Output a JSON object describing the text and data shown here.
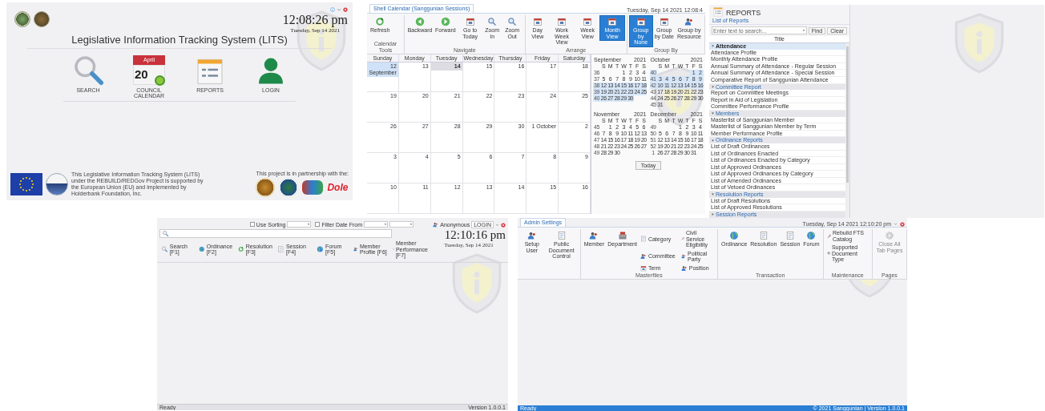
{
  "home": {
    "window_controls": [
      {
        "kind": "info"
      },
      {
        "kind": "chevron"
      },
      {
        "kind": "close"
      }
    ],
    "clock": "12:08:26 pm",
    "date": "Tuesday, Sep 14 2021",
    "title": "Legislative Information Tracking System (LITS)",
    "tiles": [
      {
        "kind": "search",
        "label": "SEARCH"
      },
      {
        "kind": "calendar",
        "label": "COUNCIL CALENDAR",
        "month": "April",
        "day": "20"
      },
      {
        "kind": "reports",
        "label": "REPORTS"
      },
      {
        "kind": "login",
        "label": "LOGIN"
      }
    ],
    "footer_text": "This Legislative Information Tracking System (LITS) under the REBUILD/REDGov Project is supported by the European Union (EU) and implemented by Holderbank Foundation, Inc.",
    "partner_text": "This project is in partnership with the:",
    "partner_logo": "Dole"
  },
  "calendar": {
    "tab": "Shell Calendar (Sanggunian Sessions)",
    "header": "Tuesday, Sep 14 2021 12:08:4",
    "ribbon_groups": [
      {
        "label": "Calendar Tools",
        "buttons": [
          {
            "kind": "refresh",
            "label": "Refresh",
            "selected": false
          }
        ]
      },
      {
        "label": "Navigate",
        "buttons": [
          {
            "kind": "back",
            "label": "Backward",
            "selected": false
          },
          {
            "kind": "forward",
            "label": "Forward",
            "selected": false
          },
          {
            "kind": "calendar",
            "label": "Go to Today",
            "selected": false
          },
          {
            "kind": "zoom",
            "label": "Zoom In",
            "selected": false
          },
          {
            "kind": "zoom",
            "label": "Zoom Out",
            "selected": false
          }
        ]
      },
      {
        "label": "Arrange",
        "buttons": [
          {
            "kind": "calendar",
            "label": "Day View",
            "selected": false
          },
          {
            "kind": "calendar",
            "label": "Work Week View",
            "selected": false
          },
          {
            "kind": "calendar",
            "label": "Week View",
            "selected": false
          },
          {
            "kind": "calendar",
            "label": "Month View",
            "selected": true
          }
        ]
      },
      {
        "label": "Group By",
        "buttons": [
          {
            "kind": "calendar",
            "label": "Group by None",
            "selected": true
          },
          {
            "kind": "calendar",
            "label": "Group by Date",
            "selected": false
          },
          {
            "kind": "people",
            "label": "Group by Resource",
            "selected": false
          }
        ]
      }
    ],
    "day_names": [
      "Sunday",
      "Monday",
      "Tuesday",
      "Wednesday",
      "Thursday",
      "Friday",
      "Saturday"
    ],
    "weeks": [
      {
        "days": [
          {
            "label": "12 September",
            "selected": true,
            "today": false
          },
          {
            "label": "13",
            "selected": false,
            "today": false
          },
          {
            "label": "14",
            "selected": false,
            "today": true
          },
          {
            "label": "15",
            "selected": false,
            "today": false
          },
          {
            "label": "16",
            "selected": false,
            "today": false
          },
          {
            "label": "17",
            "selected": false,
            "today": false
          },
          {
            "label": "18",
            "selected": false,
            "today": false
          }
        ]
      },
      {
        "days": [
          {
            "label": "19",
            "selected": false,
            "today": false
          },
          {
            "label": "20",
            "selected": false,
            "today": false
          },
          {
            "label": "21",
            "selected": false,
            "today": false
          },
          {
            "label": "22",
            "selected": false,
            "today": false
          },
          {
            "label": "23",
            "selected": false,
            "today": false
          },
          {
            "label": "24",
            "selected": false,
            "today": false
          },
          {
            "label": "25",
            "selected": false,
            "today": false
          }
        ]
      },
      {
        "days": [
          {
            "label": "26",
            "selected": false,
            "today": false
          },
          {
            "label": "27",
            "selected": false,
            "today": false
          },
          {
            "label": "28",
            "selected": false,
            "today": false
          },
          {
            "label": "29",
            "selected": false,
            "today": false
          },
          {
            "label": "30",
            "selected": false,
            "today": false
          },
          {
            "label": "1 October",
            "selected": false,
            "today": false
          },
          {
            "label": "2",
            "selected": false,
            "today": false
          }
        ]
      },
      {
        "days": [
          {
            "label": "3",
            "selected": false,
            "today": false
          },
          {
            "label": "4",
            "selected": false,
            "today": false
          },
          {
            "label": "5",
            "selected": false,
            "today": false
          },
          {
            "label": "6",
            "selected": false,
            "today": false
          },
          {
            "label": "7",
            "selected": false,
            "today": false
          },
          {
            "label": "8",
            "selected": false,
            "today": false
          },
          {
            "label": "9",
            "selected": false,
            "today": false
          }
        ]
      },
      {
        "days": [
          {
            "label": "10",
            "selected": false,
            "today": false
          },
          {
            "label": "11",
            "selected": false,
            "today": false
          },
          {
            "label": "12",
            "selected": false,
            "today": false
          },
          {
            "label": "13",
            "selected": false,
            "today": false
          },
          {
            "label": "14",
            "selected": false,
            "today": false
          },
          {
            "label": "15",
            "selected": false,
            "today": false
          },
          {
            "label": "16",
            "selected": false,
            "today": false
          }
        ]
      }
    ],
    "mini_months": [
      {
        "month": "September",
        "year": "2021",
        "weekdays": [
          "S",
          "M",
          "T",
          "W",
          "T",
          "F",
          "S"
        ],
        "weeks": [
          {
            "number": "36",
            "days": [
              "1",
              "2",
              "3",
              "4"
            ],
            "selected": false
          },
          {
            "number": "37",
            "days": [
              "5",
              "6",
              "7",
              "8",
              "9",
              "10",
              "11"
            ],
            "selected": false
          },
          {
            "number": "38",
            "days": [
              "12",
              "13",
              "14",
              "15",
              "16",
              "17",
              "18"
            ],
            "selected": true
          },
          {
            "number": "39",
            "days": [
              "19",
              "20",
              "21",
              "22",
              "23",
              "24",
              "25"
            ],
            "selected": true
          },
          {
            "number": "40",
            "days": [
              "26",
              "27",
              "28",
              "29",
              "30"
            ],
            "selected": true
          }
        ]
      },
      {
        "month": "October",
        "year": "2021",
        "weekdays": [
          "S",
          "M",
          "T",
          "W",
          "T",
          "F",
          "S"
        ],
        "weeks": [
          {
            "number": "40",
            "days": [
              "1",
              "2"
            ],
            "selected": true
          },
          {
            "number": "41",
            "days": [
              "3",
              "4",
              "5",
              "6",
              "7",
              "8",
              "9"
            ],
            "selected": true
          },
          {
            "number": "42",
            "days": [
              "10",
              "11",
              "12",
              "13",
              "14",
              "15",
              "16"
            ],
            "selected": true
          },
          {
            "number": "43",
            "days": [
              "17",
              "18",
              "19",
              "20",
              "21",
              "22",
              "23"
            ],
            "selected": false
          },
          {
            "number": "44",
            "days": [
              "24",
              "25",
              "26",
              "27",
              "28",
              "29",
              "30"
            ],
            "selected": false
          },
          {
            "number": "45",
            "days": [
              "31"
            ],
            "selected": false
          }
        ]
      },
      {
        "month": "November",
        "year": "2021",
        "weekdays": [
          "S",
          "M",
          "T",
          "W",
          "T",
          "F",
          "S"
        ],
        "weeks": [
          {
            "number": "45",
            "days": [
              "1",
              "2",
              "3",
              "4",
              "5",
              "6"
            ],
            "selected": false
          },
          {
            "number": "46",
            "days": [
              "7",
              "8",
              "9",
              "10",
              "11",
              "12",
              "13"
            ],
            "selected": false
          },
          {
            "number": "47",
            "days": [
              "14",
              "15",
              "16",
              "17",
              "18",
              "19",
              "20"
            ],
            "selected": false
          },
          {
            "number": "48",
            "days": [
              "21",
              "22",
              "23",
              "24",
              "25",
              "26",
              "27"
            ],
            "selected": false
          },
          {
            "number": "49",
            "days": [
              "28",
              "29",
              "30"
            ],
            "selected": false
          }
        ]
      },
      {
        "month": "December",
        "year": "2021",
        "weekdays": [
          "S",
          "M",
          "T",
          "W",
          "T",
          "F",
          "S"
        ],
        "weeks": [
          {
            "number": "49",
            "days": [
              "1",
              "2",
              "3",
              "4"
            ],
            "selected": false
          },
          {
            "number": "50",
            "days": [
              "5",
              "6",
              "7",
              "8",
              "9",
              "10",
              "11"
            ],
            "selected": false
          },
          {
            "number": "51",
            "days": [
              "12",
              "13",
              "14",
              "15",
              "16",
              "17",
              "18"
            ],
            "selected": false
          },
          {
            "number": "52",
            "days": [
              "19",
              "20",
              "21",
              "22",
              "23",
              "24",
              "25"
            ],
            "selected": false
          },
          {
            "number": "1",
            "days": [
              "26",
              "27",
              "28",
              "29",
              "30",
              "31"
            ],
            "selected": false
          }
        ]
      }
    ],
    "today_button": "Today"
  },
  "reports": {
    "title": "REPORTS",
    "pane_title": "List of Reports",
    "search_placeholder": "Enter text to search...",
    "find": "Find",
    "clear": "Clear",
    "column": "Title",
    "groups": [
      {
        "label": "Attendance",
        "expanded": true,
        "selected": true,
        "items": [
          "Attendance Profile",
          "Monthly Attendance Profile",
          "Annual Summary of Attendance - Regular Session",
          "Annual Summary of Attendance - Special Session",
          "Comparative Report of Sanggunian Attendance"
        ]
      },
      {
        "label": "Committee Report",
        "expanded": true,
        "selected": false,
        "items": [
          "Report on Committee Meetings",
          "Report in Aid of Legislation",
          "Committee Performance Profile"
        ]
      },
      {
        "label": "Members",
        "expanded": true,
        "selected": false,
        "items": [
          "Masterlist of Sanggunian Member",
          "Masterlist of Sanggunian Member by Term",
          "Member Performance Profile"
        ]
      },
      {
        "label": "Ordinance Reports",
        "expanded": true,
        "selected": false,
        "items": [
          "List of Draft Ordinances",
          "List of Ordinances Enacted",
          "List of Ordinances Enacted by Category",
          "List of Approved Ordinances",
          "List of Approved Ordinances by Category",
          "List of Amended Ordinances",
          "List of Vetoed Ordinances"
        ]
      },
      {
        "label": "Resolution Reports",
        "expanded": true,
        "selected": false,
        "items": [
          "List of Draft Resolutions",
          "List of Approved Resolutions"
        ]
      },
      {
        "label": "Session Reports",
        "expanded": false,
        "selected": false
      }
    ]
  },
  "search": {
    "filters": [
      {
        "kind": "dropdown",
        "label": "Use Sorting",
        "checked": false
      },
      {
        "kind": "dates",
        "label": "Filter Date From",
        "checked": false
      }
    ],
    "buttons": [
      {
        "kind": "search",
        "label": "Search [F1]"
      },
      {
        "kind": "globe",
        "label": "Ordinance [F2]"
      },
      {
        "kind": "refresh",
        "label": "Resolution [F3]"
      },
      {
        "kind": "document",
        "label": "Session [F4]"
      },
      {
        "kind": "globe",
        "label": "Forum [F5]"
      },
      {
        "kind": "people",
        "label": "Member Profile [F6]"
      },
      {
        "kind": "info",
        "label": "Member Performance [F7]"
      }
    ],
    "user": "Anonymous",
    "login": "LOGIN",
    "clock": "12:10:16 pm",
    "date": "Tuesday, Sep 14 2021",
    "status": "Ready",
    "version": "Version 1.0.0.1"
  },
  "admin": {
    "tab": "Admin Settings",
    "header": "Tuesday, Sep 14 2021 12:10:20 pm",
    "groups": [
      {
        "buttons": [
          {
            "kind": "people",
            "label": "Setup User",
            "small": false,
            "disabled": false
          },
          {
            "kind": "document",
            "label": "Public Document Control",
            "small": false,
            "disabled": false
          }
        ]
      },
      {
        "label": "Masterfiles",
        "buttons": [
          {
            "kind": "people",
            "label": "Member",
            "small": false,
            "disabled": false
          },
          {
            "kind": "building",
            "label": "Department",
            "small": false,
            "disabled": false
          },
          {
            "kind": "document",
            "label": "Category",
            "small": true,
            "disabled": false
          },
          {
            "kind": "people",
            "label": "Committee",
            "small": true,
            "disabled": false
          },
          {
            "kind": "calendar",
            "label": "Term",
            "small": true,
            "disabled": false
          },
          {
            "kind": "wrench",
            "label": "Civil Service Eligibility",
            "small": true,
            "disabled": false
          },
          {
            "kind": "people",
            "label": "Political Party",
            "small": true,
            "disabled": false
          },
          {
            "kind": "people",
            "label": "Position",
            "small": true,
            "disabled": false
          }
        ]
      },
      {
        "label": "Transaction",
        "buttons": [
          {
            "kind": "globe",
            "label": "Ordinance",
            "small": false,
            "disabled": false
          },
          {
            "kind": "document",
            "label": "Resolution",
            "small": false,
            "disabled": false
          },
          {
            "kind": "document",
            "label": "Session",
            "small": false,
            "disabled": false
          },
          {
            "kind": "globe",
            "label": "Forum",
            "small": false,
            "disabled": false
          }
        ]
      },
      {
        "label": "Maintenance",
        "buttons": [
          {
            "kind": "wrench",
            "label": "Rebuild FTS Catalog",
            "small": true,
            "disabled": false
          },
          {
            "kind": "gear",
            "label": "Supported Document Type",
            "small": true,
            "disabled": false
          }
        ]
      },
      {
        "label": "Pages",
        "buttons": [
          {
            "kind": "gear",
            "label": "Close All Tab Pages",
            "small": false,
            "disabled": true
          }
        ]
      }
    ],
    "status": "Ready",
    "version": "© 2021 Sanggunian  |  Version 1.0.0.1"
  }
}
